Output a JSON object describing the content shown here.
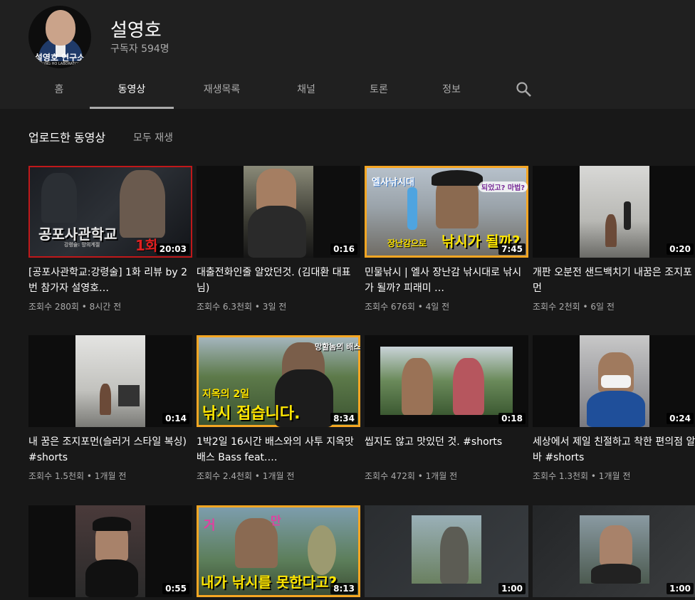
{
  "channel": {
    "name": "설영호",
    "subscribers": "구독자 594명",
    "avatar_text": "설영호 연구소",
    "avatar_subtext": "YOUNG HO LABORATORY"
  },
  "tabs": [
    {
      "label": "홈"
    },
    {
      "label": "동영상"
    },
    {
      "label": "재생목록"
    },
    {
      "label": "채널"
    },
    {
      "label": "토론"
    },
    {
      "label": "정보"
    }
  ],
  "section": {
    "title": "업로드한 동영상",
    "play_all": "모두 재생"
  },
  "videos": [
    {
      "title": "[공포사관학교:강령술] 1화 리뷰 by 2번 참가자 설영호…",
      "meta": "조회수 280회 • 8시간 전",
      "duration": "20:03",
      "overlay": [
        "공포사관학교",
        "1화",
        "강령술: 망의계절"
      ]
    },
    {
      "title": "대출전화인줄 알았던것. (김대환 대표님)",
      "meta": "조회수 6.3천회 • 3일 전",
      "duration": "0:16"
    },
    {
      "title": "민물낚시 | 엘사 장난감 낚시대로 낚시가 될까? 피래미 …",
      "meta": "조회수 676회 • 4일 전",
      "duration": "7:45",
      "overlay": [
        "엘사낚시대",
        "장난감으로",
        "낚시가 될까?",
        "되었고? 마법?"
      ]
    },
    {
      "title": "개판 오분전 샌드백치기 내꿈은 조지포먼",
      "meta": "조회수 2천회 • 6일 전",
      "duration": "0:20"
    },
    {
      "title": "내 꿈은 조지포먼(슬러거 스타일 복싱) #shorts",
      "meta": "조회수 1.5천회 • 1개월 전",
      "duration": "0:14"
    },
    {
      "title": "1박2일 16시간 배스와의 사투 지옥맛 배스 Bass feat.…",
      "meta": "조회수 2.4천회 • 1개월 전",
      "duration": "8:34",
      "overlay": [
        "지옥의 2일",
        "낚시 접습니다.",
        "망할놈의 배스"
      ]
    },
    {
      "title": "씹지도 않고 맛있던 것. #shorts",
      "meta": "조회수 472회 • 1개월 전",
      "duration": "0:18"
    },
    {
      "title": "세상에서 제일 친절하고 착한 편의점 알바 #shorts",
      "meta": "조회수 1.3천회 • 1개월 전",
      "duration": "0:24"
    },
    {
      "title": "",
      "meta": "",
      "duration": "0:55"
    },
    {
      "title": "",
      "meta": "",
      "duration": "8:13",
      "overlay": [
        "거",
        "만",
        "내가 낚시를 못한다고?"
      ]
    },
    {
      "title": "",
      "meta": "",
      "duration": "1:00"
    },
    {
      "title": "",
      "meta": "",
      "duration": "1:00"
    }
  ],
  "colors": {
    "background": "#181818",
    "header": "#202020",
    "secondary_text": "#aaaaaa",
    "thumb_border_orange": "#f5a623",
    "thumb_border_red": "#c0181a",
    "overlay_yellow": "#ffe600"
  }
}
